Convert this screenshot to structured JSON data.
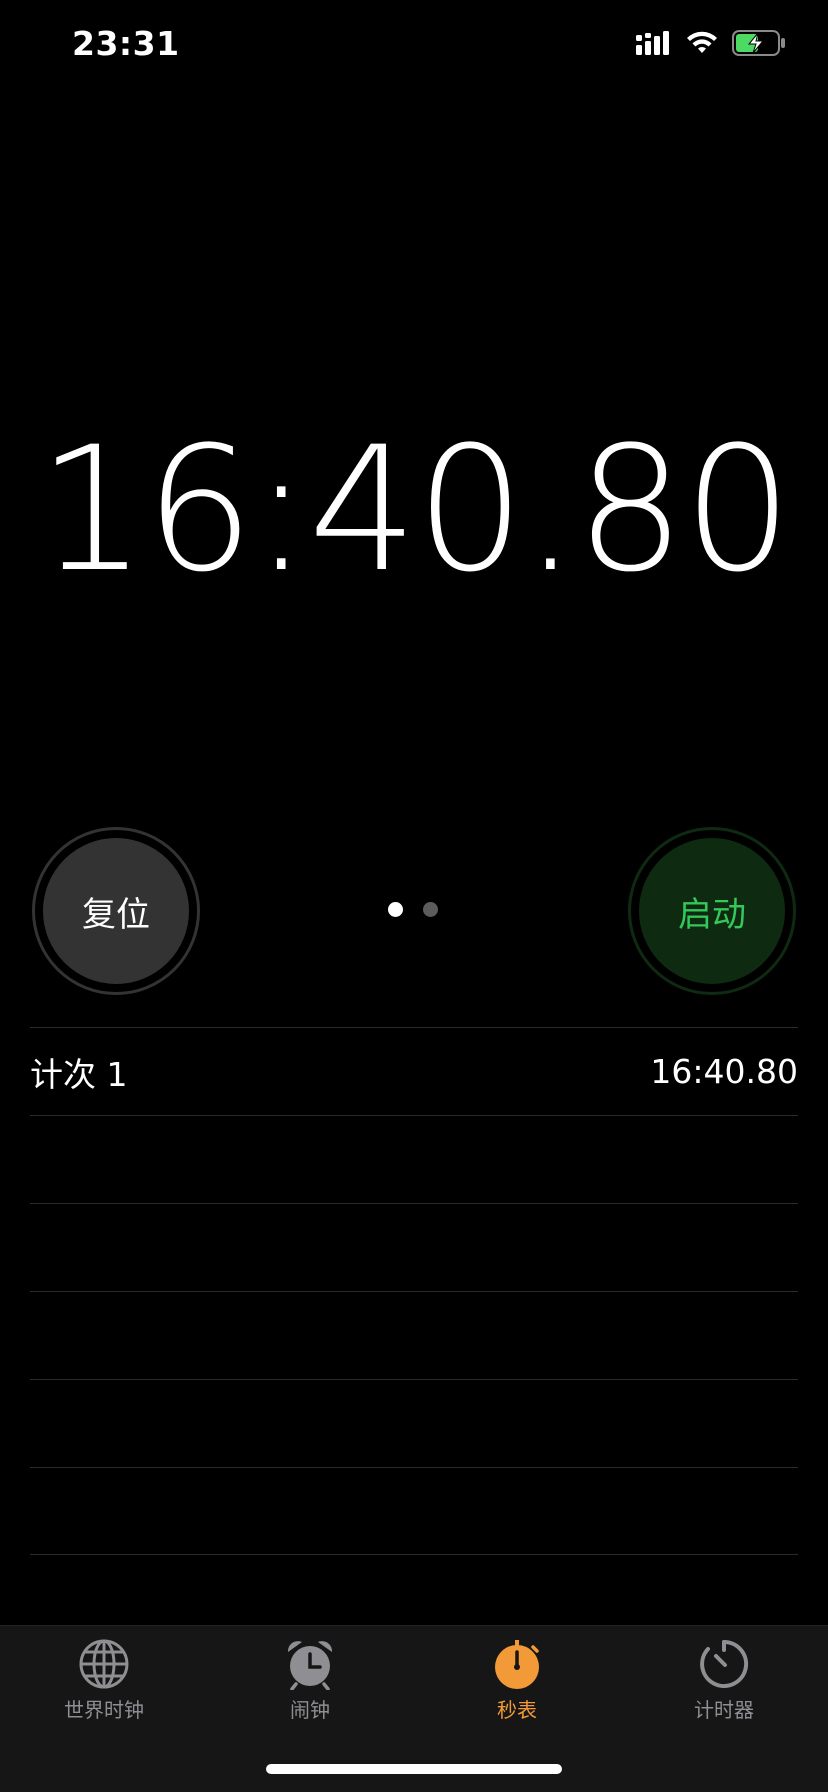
{
  "status_bar": {
    "time": "23:31",
    "icons": [
      "signal-icon",
      "wifi-icon",
      "battery-charging-icon"
    ]
  },
  "stopwatch": {
    "display": "16:40.80"
  },
  "buttons": {
    "reset_label": "复位",
    "start_label": "启动"
  },
  "pager": {
    "pages": 2,
    "current": 1
  },
  "laps": [
    {
      "label": "计次 1",
      "time": "16:40.80"
    },
    {
      "label": "",
      "time": ""
    },
    {
      "label": "",
      "time": ""
    },
    {
      "label": "",
      "time": ""
    },
    {
      "label": "",
      "time": ""
    },
    {
      "label": "",
      "time": ""
    }
  ],
  "tabs": [
    {
      "label": "世界时钟",
      "icon": "globe-icon",
      "active": false
    },
    {
      "label": "闹钟",
      "icon": "alarm-clock-icon",
      "active": false
    },
    {
      "label": "秒表",
      "icon": "stopwatch-icon",
      "active": true
    },
    {
      "label": "计时器",
      "icon": "timer-icon",
      "active": false
    }
  ],
  "colors": {
    "accent_orange": "#f19a37",
    "start_green": "#34c759",
    "tab_inactive": "#8e8e93"
  }
}
